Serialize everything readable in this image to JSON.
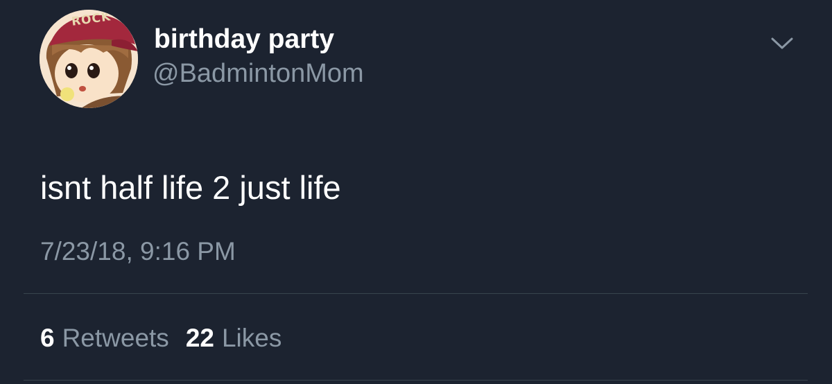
{
  "tweet": {
    "display_name": "birthday party",
    "handle": "@BadmintonMom",
    "text": "isnt half life 2 just life",
    "timestamp": "7/23/18, 9:16 PM",
    "avatar_icon": "avatar-anime-character-icon",
    "avatar_cap_text": "ROCK",
    "menu_icon": "chevron-down-icon"
  },
  "stats": {
    "retweets_count": "6",
    "retweets_label": "Retweets",
    "likes_count": "22",
    "likes_label": "Likes"
  },
  "colors": {
    "background": "#1c2330",
    "primary_text": "#ffffff",
    "secondary_text": "#8b98a5",
    "divider": "#38444d"
  }
}
